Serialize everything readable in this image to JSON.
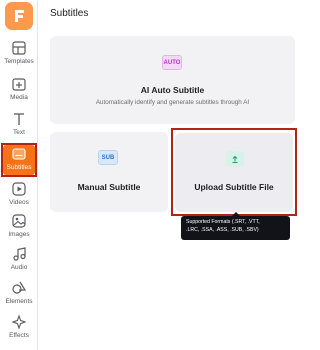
{
  "sidebar": {
    "items": [
      {
        "label": "Templates",
        "icon": "templates-icon"
      },
      {
        "label": "Media",
        "icon": "media-icon"
      },
      {
        "label": "Text",
        "icon": "text-icon"
      },
      {
        "label": "Subtitles",
        "icon": "subtitles-icon",
        "active": true
      },
      {
        "label": "Videos",
        "icon": "videos-icon"
      },
      {
        "label": "Images",
        "icon": "images-icon"
      },
      {
        "label": "Audio",
        "icon": "audio-icon"
      },
      {
        "label": "Elements",
        "icon": "elements-icon"
      },
      {
        "label": "Effects",
        "icon": "effects-icon"
      }
    ],
    "logo": "F"
  },
  "main": {
    "title": "Subtitles",
    "ai_card": {
      "badge": "AUTO",
      "title": "AI Auto Subtitle",
      "description": "Automatically identify and generate subtitles through AI"
    },
    "manual_card": {
      "badge": "SUB",
      "title": "Manual Subtitle"
    },
    "upload_card": {
      "title": "Upload Subtitle File",
      "tooltip_line1": "Supported Formats (.SRT, .VTT,",
      "tooltip_line2": ".LRC, .SSA, .ASS, .SUB, .SBV)"
    }
  },
  "colors": {
    "accent": "#f97316",
    "highlight_frame": "#b42318",
    "ai_badge": "#b537c4",
    "sub_badge": "#2f6fd6",
    "upload_badge": "#1e9e6a"
  }
}
